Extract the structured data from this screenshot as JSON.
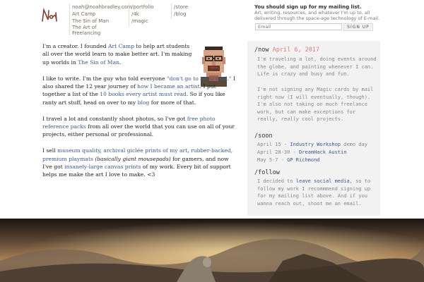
{
  "header": {
    "logo_text": "Noah",
    "nav_col1": [
      "noah@noahbradley.com",
      "Art Camp",
      "The Sin of Man",
      "The Art of Freelancing"
    ],
    "nav_col2": [
      "/portfolio",
      "/4k",
      "/magic"
    ],
    "nav_col3": [
      "/store",
      "/blog"
    ]
  },
  "mailing": {
    "title": "You should sign up for my mailing list.",
    "description": "Art, writing, resources, and whatever I'm up to, all delivered through the space-age technology of E-mail.",
    "email_placeholder": "Email",
    "button_label": "SIGN UP"
  },
  "main": {
    "p1": {
      "t1": "I'm a creator. I founded ",
      "l1": "Art Camp",
      "t2": " to help art students all over the world learn to make better art. I'm making up worlds in ",
      "l2": "The Sin of Man",
      "t3": "."
    },
    "p2": {
      "t1": "I like to write. I'm the guy who told everyone ",
      "l1": "\"don't go to art school.\"",
      "t2": " I also shared the 12 year journey of ",
      "l2": "how I became an artist",
      "t3": ". I put together a list of the ",
      "l3": "10 books every artist must read",
      "t4": ". So if you like ranty art stuff, head on over to my ",
      "l4": "blog",
      "t5": " for more of that."
    },
    "p3": {
      "t1": "I travel a lot and constantly shoot photos, so I've got ",
      "l1": "free photo reference packs",
      "t2": " from all over the world that you can use on all of your projects, either personal or professional."
    },
    "p4": {
      "t1": "I sell ",
      "l1": "museum quality",
      "t2": ", ",
      "l2": "archival giclée prints of my art",
      "t3": ", ",
      "l3": "rubber-backed, premium playmats",
      "t4": " ",
      "i1": "(basically giant mousepads)",
      "t5": " for gamers, and now I've got ",
      "l4": "insanely-large canvas prints",
      "t6": " of my work. Every bit of support helps me make the art I love to make. <3"
    }
  },
  "sidebar": {
    "now_head": "/now",
    "now_date": "April 6, 2017",
    "now_p1": "I'm traveling a lot, doing events around the globe, and painting whenever I can. Life is crazy and busy and fun.",
    "now_p2a": "I'm not signing any Magic cards by mail right now (I will eventually, though). I'm also not taking on much freelance work, but can make exceptions for really, ",
    "now_p2i": "really",
    "now_p2b": " cool projects.",
    "soon_head": "/soon",
    "events": [
      {
        "date": "April 15 - ",
        "name": "Industry Workshop",
        "suffix": " demo day"
      },
      {
        "date": "April 28-30 - ",
        "name": "DreamHack Austin",
        "suffix": ""
      },
      {
        "date": "May 5-7 - ",
        "name": "GP Richmond",
        "suffix": ""
      }
    ],
    "follow_head": "/follow",
    "follow_t1": "I decided to ",
    "follow_l1": "leave social media",
    "follow_t2": ", so to follow my work I recommmend signing up for my mailing list above. And if you wanna reach out, shoot me an email."
  },
  "colors": {
    "link": "#3a5a8c",
    "date": "#e08080",
    "sidebar_bg": "#f2f2f2"
  }
}
